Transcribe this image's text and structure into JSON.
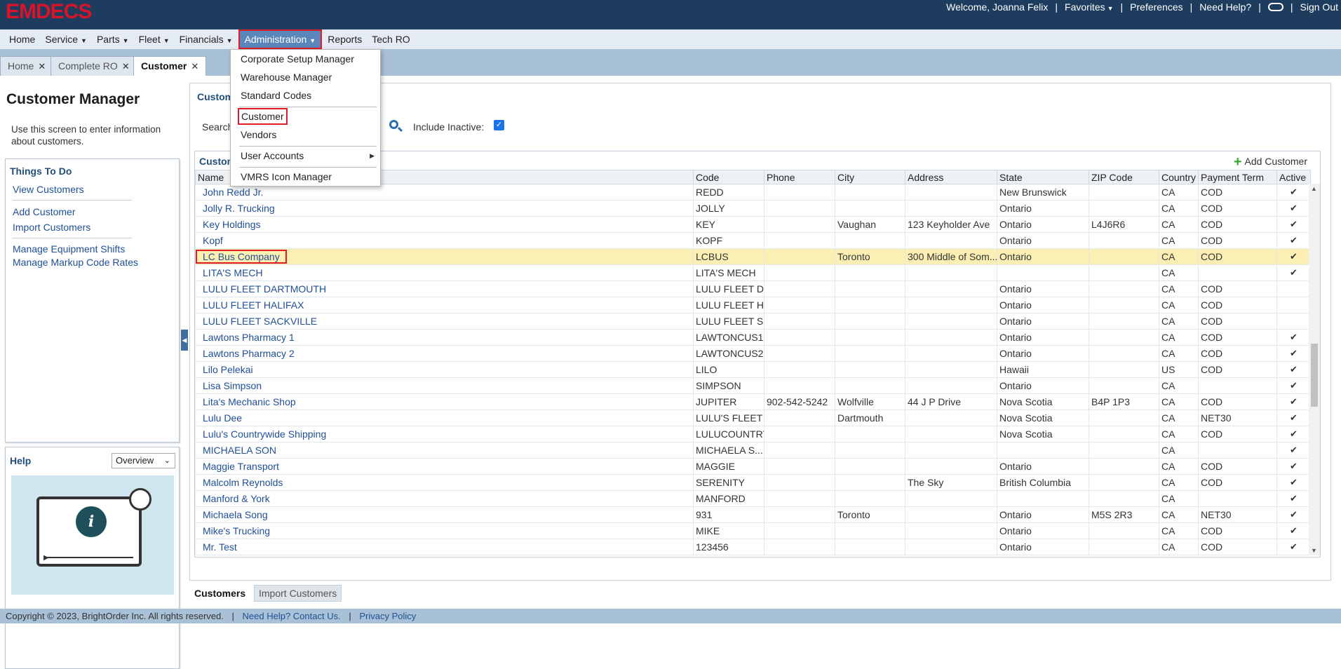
{
  "app": {
    "logo": "EMDECS",
    "welcome": "Welcome, Joanna Felix",
    "favorites": "Favorites",
    "preferences": "Preferences",
    "need_help": "Need Help?",
    "sign_out": "Sign Out"
  },
  "menubar": {
    "items": [
      "Home",
      "Service",
      "Parts",
      "Fleet",
      "Financials",
      "Administration",
      "Reports",
      "Tech RO"
    ]
  },
  "tabs": [
    "Home",
    "Complete RO",
    "Customer"
  ],
  "left": {
    "title": "Customer Manager",
    "description": "Use this screen to enter information about customers.",
    "todo_title": "Things To Do",
    "todo_links": [
      "View Customers",
      "Add Customer",
      "Import Customers",
      "Manage Equipment Shifts",
      "Manage Markup Code Rates"
    ],
    "help_title": "Help",
    "help_select": "Overview"
  },
  "main": {
    "heading": "Custom",
    "search_label": "Search",
    "include_inactive": "Include Inactive:",
    "grid_title": "Custom",
    "add_customer": "Add Customer"
  },
  "table": {
    "columns": [
      "Name",
      "Code",
      "Phone",
      "City",
      "Address",
      "State",
      "ZIP Code",
      "Country",
      "Payment Term",
      "Active"
    ],
    "rows": [
      {
        "name": "John Redd Jr.",
        "code": "REDD",
        "phone": "",
        "city": "",
        "address": "",
        "state": "New Brunswick",
        "zip": "",
        "country": "CA",
        "term": "COD",
        "active": "✔"
      },
      {
        "name": "Jolly R. Trucking",
        "code": "JOLLY",
        "phone": "",
        "city": "",
        "address": "",
        "state": "Ontario",
        "zip": "",
        "country": "CA",
        "term": "COD",
        "active": "✔"
      },
      {
        "name": "Key Holdings",
        "code": "KEY",
        "phone": "",
        "city": "Vaughan",
        "address": "123 Keyholder Ave",
        "state": "Ontario",
        "zip": "L4J6R6",
        "country": "CA",
        "term": "COD",
        "active": "✔"
      },
      {
        "name": "Kopf",
        "code": "KOPF",
        "phone": "",
        "city": "",
        "address": "",
        "state": "Ontario",
        "zip": "",
        "country": "CA",
        "term": "COD",
        "active": "✔"
      },
      {
        "name": "LC Bus Company",
        "code": "LCBUS",
        "phone": "",
        "city": "Toronto",
        "address": "300 Middle of Som...",
        "state": "Ontario",
        "zip": "",
        "country": "CA",
        "term": "COD",
        "active": "✔",
        "selected": true
      },
      {
        "name": "LITA'S MECH",
        "code": "LITA'S MECH",
        "phone": "",
        "city": "",
        "address": "",
        "state": "",
        "zip": "",
        "country": "CA",
        "term": "",
        "active": "✔"
      },
      {
        "name": "LULU FLEET DARTMOUTH",
        "code": "LULU FLEET D",
        "phone": "",
        "city": "",
        "address": "",
        "state": "Ontario",
        "zip": "",
        "country": "CA",
        "term": "COD",
        "active": ""
      },
      {
        "name": "LULU FLEET HALIFAX",
        "code": "LULU FLEET H",
        "phone": "",
        "city": "",
        "address": "",
        "state": "Ontario",
        "zip": "",
        "country": "CA",
        "term": "COD",
        "active": ""
      },
      {
        "name": "LULU FLEET SACKVILLE",
        "code": "LULU FLEET S",
        "phone": "",
        "city": "",
        "address": "",
        "state": "Ontario",
        "zip": "",
        "country": "CA",
        "term": "COD",
        "active": ""
      },
      {
        "name": "Lawtons Pharmacy 1",
        "code": "LAWTONCUS1",
        "phone": "",
        "city": "",
        "address": "",
        "state": "Ontario",
        "zip": "",
        "country": "CA",
        "term": "COD",
        "active": "✔"
      },
      {
        "name": "Lawtons Pharmacy 2",
        "code": "LAWTONCUS2",
        "phone": "",
        "city": "",
        "address": "",
        "state": "Ontario",
        "zip": "",
        "country": "CA",
        "term": "COD",
        "active": "✔"
      },
      {
        "name": "Lilo Pelekai",
        "code": "LILO",
        "phone": "",
        "city": "",
        "address": "",
        "state": "Hawaii",
        "zip": "",
        "country": "US",
        "term": "COD",
        "active": "✔"
      },
      {
        "name": "Lisa Simpson",
        "code": "SIMPSON",
        "phone": "",
        "city": "",
        "address": "",
        "state": "Ontario",
        "zip": "",
        "country": "CA",
        "term": "",
        "active": "✔"
      },
      {
        "name": "Lita's Mechanic Shop",
        "code": "JUPITER",
        "phone": "902-542-5242",
        "city": "Wolfville",
        "address": "44 J P Drive",
        "state": "Nova Scotia",
        "zip": "B4P 1P3",
        "country": "CA",
        "term": "COD",
        "active": "✔"
      },
      {
        "name": "Lulu Dee",
        "code": "LULU'S FLEET",
        "phone": "",
        "city": "Dartmouth",
        "address": "",
        "state": "Nova Scotia",
        "zip": "",
        "country": "CA",
        "term": "NET30",
        "active": "✔"
      },
      {
        "name": "Lulu's Countrywide Shipping",
        "code": "LULUCOUNTRY",
        "phone": "",
        "city": "",
        "address": "",
        "state": "Nova Scotia",
        "zip": "",
        "country": "CA",
        "term": "COD",
        "active": "✔"
      },
      {
        "name": "MICHAELA SON",
        "code": "MICHAELA S...",
        "phone": "",
        "city": "",
        "address": "",
        "state": "",
        "zip": "",
        "country": "CA",
        "term": "",
        "active": "✔"
      },
      {
        "name": "Maggie Transport",
        "code": "MAGGIE",
        "phone": "",
        "city": "",
        "address": "",
        "state": "Ontario",
        "zip": "",
        "country": "CA",
        "term": "COD",
        "active": "✔"
      },
      {
        "name": "Malcolm Reynolds",
        "code": "SERENITY",
        "phone": "",
        "city": "",
        "address": "The Sky",
        "state": "British Columbia",
        "zip": "",
        "country": "CA",
        "term": "COD",
        "active": "✔"
      },
      {
        "name": "Manford & York",
        "code": "MANFORD",
        "phone": "",
        "city": "",
        "address": "",
        "state": "",
        "zip": "",
        "country": "CA",
        "term": "",
        "active": "✔"
      },
      {
        "name": "Michaela Song",
        "code": "931",
        "phone": "",
        "city": "Toronto",
        "address": "",
        "state": "Ontario",
        "zip": "M5S 2R3",
        "country": "CA",
        "term": "NET30",
        "active": "✔"
      },
      {
        "name": "Mike's Trucking",
        "code": "MIKE",
        "phone": "",
        "city": "",
        "address": "",
        "state": "Ontario",
        "zip": "",
        "country": "CA",
        "term": "COD",
        "active": "✔"
      },
      {
        "name": "Mr. Test",
        "code": "123456",
        "phone": "",
        "city": "",
        "address": "",
        "state": "Ontario",
        "zip": "",
        "country": "CA",
        "term": "COD",
        "active": "✔"
      }
    ]
  },
  "dropdown": {
    "items": [
      "Corporate Setup Manager",
      "Warehouse Manager",
      "Standard Codes",
      "Customer",
      "Vendors",
      "User Accounts",
      "VMRS Icon Manager"
    ]
  },
  "bottom_tabs": [
    "Customers",
    "Import Customers"
  ],
  "footer": {
    "copyright": "Copyright © 2023, BrightOrder Inc. All rights reserved.",
    "help_link": "Need Help? Contact Us.",
    "privacy": "Privacy Policy"
  },
  "colors": {
    "topbar": "#1e3d5e",
    "logo": "#d8132a",
    "highlight_outline": "#e01b24",
    "selected_row": "#fcefb4",
    "link": "#1f4f94"
  }
}
